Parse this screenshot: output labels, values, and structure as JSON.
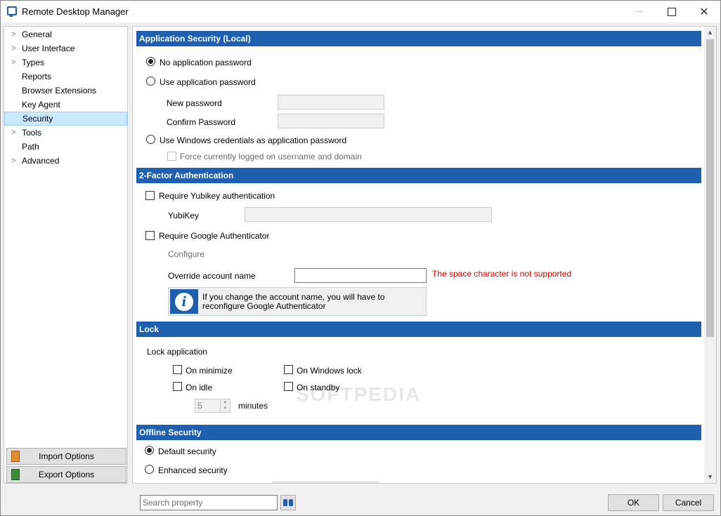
{
  "window": {
    "title": "Remote Desktop Manager"
  },
  "nav": {
    "items": [
      {
        "label": "General",
        "expandable": true
      },
      {
        "label": "User Interface",
        "expandable": true
      },
      {
        "label": "Types",
        "expandable": true
      },
      {
        "label": "Reports",
        "expandable": false
      },
      {
        "label": "Browser Extensions",
        "expandable": false
      },
      {
        "label": "Key Agent",
        "expandable": false
      },
      {
        "label": "Security",
        "expandable": false,
        "selected": true
      },
      {
        "label": "Tools",
        "expandable": true
      },
      {
        "label": "Path",
        "expandable": false
      },
      {
        "label": "Advanced",
        "expandable": true
      }
    ],
    "import_label": "Import Options",
    "export_label": "Export Options"
  },
  "app_security": {
    "header": "Application Security (Local)",
    "no_password": "No application password",
    "use_password": "Use application password",
    "new_password": "New password",
    "confirm_password": "Confirm Password",
    "windows_credentials": "Use Windows credentials as application password",
    "force_logged_on": "Force currently logged on username and domain"
  },
  "two_factor": {
    "header": "2-Factor Authentication",
    "require_yubikey": "Require Yubikey authentication",
    "yubikey_label": "YubiKey",
    "require_google": "Require Google Authenticator",
    "configure": "Configure",
    "override_account": "Override account name",
    "space_error": "The space character is not supported",
    "info_text": "If you change the account name, you will have to reconfigure Google Authenticator"
  },
  "lock": {
    "header": "Lock",
    "lock_application": "Lock application",
    "on_minimize": "On minimize",
    "on_windows_lock": "On Windows lock",
    "on_idle": "On idle",
    "on_standby": "On standby",
    "idle_minutes": "5",
    "minutes_label": "minutes"
  },
  "offline": {
    "header": "Offline Security",
    "default_security": "Default security",
    "enhanced_security": "Enhanced security"
  },
  "footer": {
    "search_placeholder": "Search property",
    "ok": "OK",
    "cancel": "Cancel"
  },
  "watermark": "SOFTPEDIA",
  "colors": {
    "section_header": "#1e5fb0",
    "error": "#e00000",
    "selection": "#cce8ff"
  }
}
